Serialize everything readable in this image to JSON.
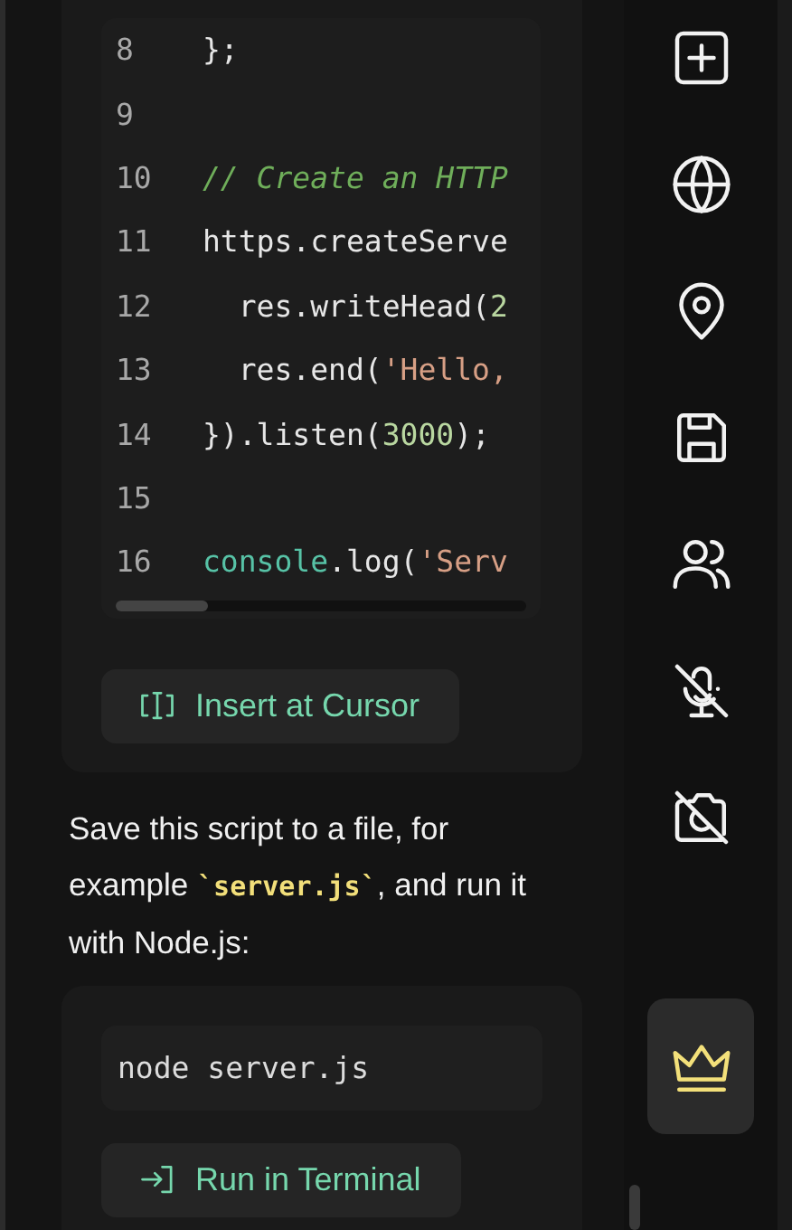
{
  "code_block": {
    "lines": [
      {
        "number": "8",
        "tokens": [
          {
            "kind": "plain",
            "text": "};"
          }
        ]
      },
      {
        "number": "9"
      },
      {
        "number": "10",
        "tokens": [
          {
            "kind": "comment",
            "text": "// Create an HTTP"
          }
        ]
      },
      {
        "number": "11",
        "tokens": [
          {
            "kind": "plain",
            "text": "https.createServe"
          }
        ]
      },
      {
        "number": "12",
        "tokens": [
          {
            "kind": "plain",
            "text": "  res.writeHead("
          },
          {
            "kind": "number",
            "text": "2"
          }
        ]
      },
      {
        "number": "13",
        "tokens": [
          {
            "kind": "plain",
            "text": "  res.end("
          },
          {
            "kind": "string",
            "text": "'Hello,"
          }
        ]
      },
      {
        "number": "14",
        "tokens": [
          {
            "kind": "plain",
            "text": "}).listen("
          },
          {
            "kind": "number",
            "text": "3000"
          },
          {
            "kind": "plain",
            "text": ");"
          }
        ]
      },
      {
        "number": "15"
      },
      {
        "number": "16",
        "tokens": [
          {
            "kind": "builtin",
            "text": "console"
          },
          {
            "kind": "plain",
            "text": ".log("
          },
          {
            "kind": "string",
            "text": "'Serv"
          }
        ]
      }
    ],
    "action": {
      "label": "Insert at Cursor"
    }
  },
  "paragraph": "Save this script to a file, for example **`server.js`**, and run it with Node.js:",
  "command_block": {
    "command": "node server.js",
    "action": {
      "label": "Run in Terminal"
    }
  },
  "sidebar": {
    "items": [
      {
        "selected": false
      },
      {
        "selected": false
      },
      {
        "selected": false
      },
      {
        "selected": false
      },
      {
        "selected": false
      },
      {
        "selected": false
      },
      {
        "selected": false
      },
      {
        "selected": true
      }
    ]
  }
}
